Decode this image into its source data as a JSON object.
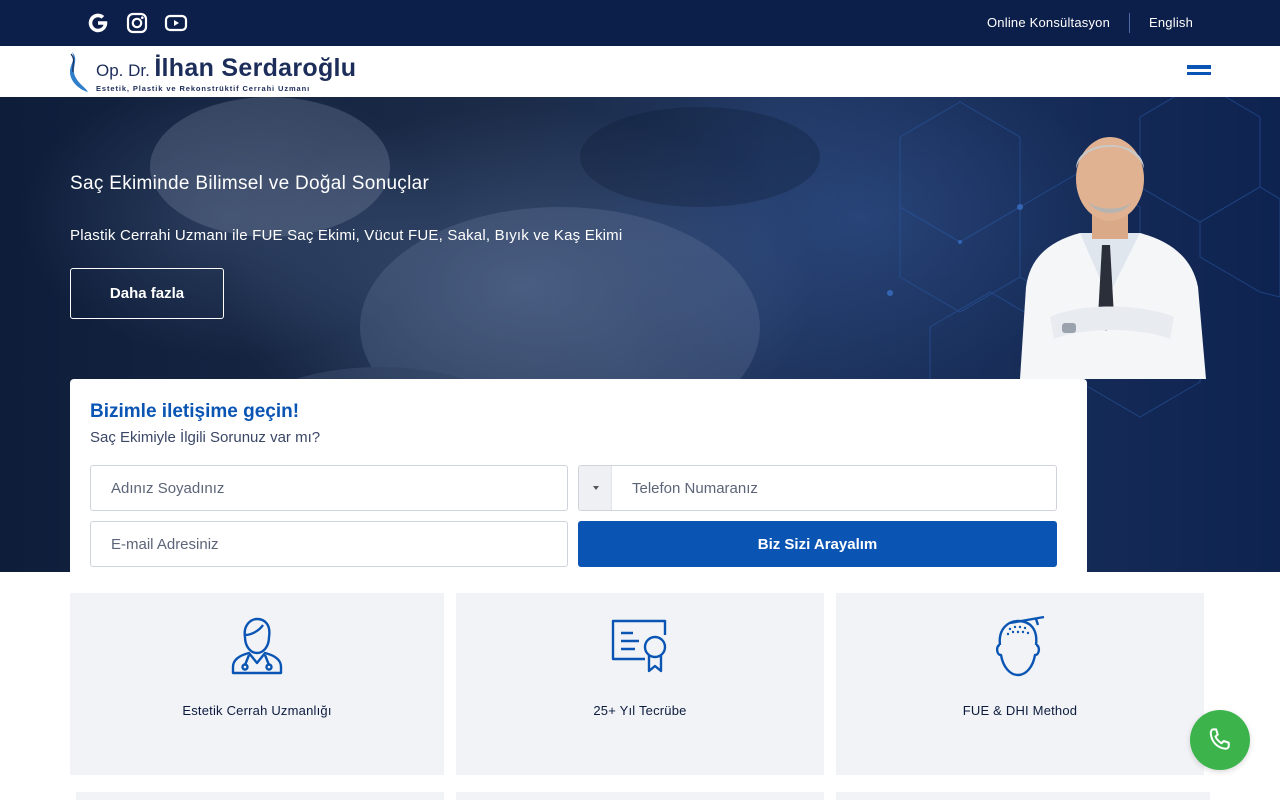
{
  "topbar": {
    "social": [
      {
        "name": "google-icon"
      },
      {
        "name": "instagram-icon"
      },
      {
        "name": "youtube-icon"
      }
    ],
    "links": {
      "consultation": "Online Konsültasyon",
      "language": "English"
    }
  },
  "header": {
    "logo": {
      "prefix": "Op. Dr.",
      "name": "İlhan Serdaroğlu",
      "tagline": "Estetik, Plastik ve Rekonstrüktif Cerrahi Uzmanı"
    },
    "menu_icon": "hamburger-menu-icon"
  },
  "hero": {
    "title": "Saç Ekiminde Bilimsel ve Doğal Sonuçlar",
    "subtitle": "Plastik Cerrahi Uzmanı ile FUE Saç Ekimi, Vücut FUE, Sakal, Bıyık ve Kaş Ekimi",
    "button_label": "Daha fazla"
  },
  "contact_form": {
    "title": "Bizimle iletişime geçin!",
    "subtitle": "Saç Ekimiyle İlgili Sorunuz var mı?",
    "name_placeholder": "Adınız Soyadınız",
    "phone_placeholder": "Telefon Numaranız",
    "email_placeholder": "E-mail Adresiniz",
    "submit_label": "Biz Sizi Arayalım"
  },
  "features": [
    {
      "icon": "surgeon-icon",
      "label": "Estetik Cerrah Uzmanlığı"
    },
    {
      "icon": "certificate-icon",
      "label": "25+ Yıl Tecrübe"
    },
    {
      "icon": "hair-transplant-head-icon",
      "label": "FUE & DHI Method"
    }
  ],
  "colors": {
    "topbar": "#0c1e4a",
    "accent": "#0a55b4",
    "call_button": "#3cb44b",
    "feature_bg": "#f1f3f6"
  }
}
